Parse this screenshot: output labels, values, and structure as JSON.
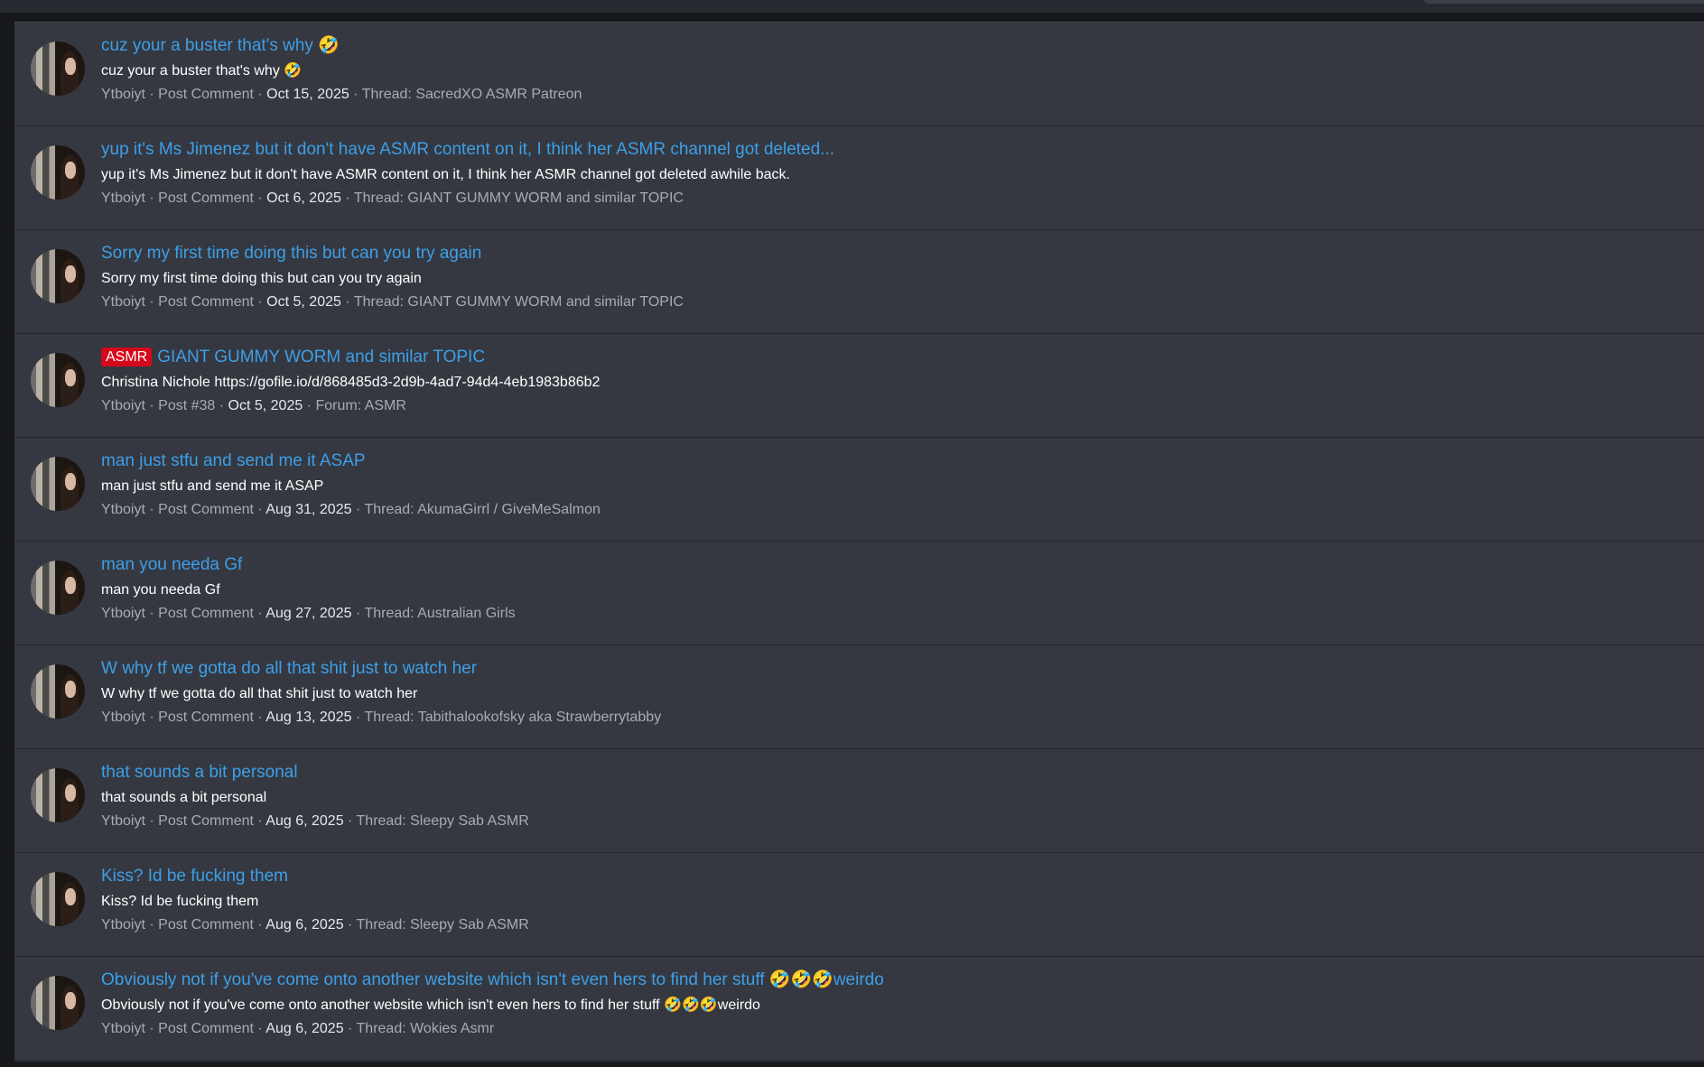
{
  "items": [
    {
      "title": "cuz your a buster that's why 🤣",
      "snippet": "cuz your a buster that's why 🤣",
      "user": "Ytboiyt",
      "type": "Post Comment",
      "date": "Oct 15, 2025",
      "location": "Thread: SacredXO ASMR Patreon"
    },
    {
      "title": "yup it's Ms Jimenez but it don't have ASMR content on it, I think her ASMR channel got deleted...",
      "snippet": "yup it's Ms Jimenez but it don't have ASMR content on it, I think her ASMR channel got deleted awhile back.",
      "user": "Ytboiyt",
      "type": "Post Comment",
      "date": "Oct 6, 2025",
      "location": "Thread: GIANT GUMMY WORM and similar TOPIC"
    },
    {
      "title": "Sorry my first time doing this but can you try again",
      "snippet": "Sorry my first time doing this but can you try again",
      "user": "Ytboiyt",
      "type": "Post Comment",
      "date": "Oct 5, 2025",
      "location": "Thread: GIANT GUMMY WORM and similar TOPIC"
    },
    {
      "prefix": "ASMR",
      "title": "GIANT GUMMY WORM and similar TOPIC",
      "snippet": "Christina Nichole https://gofile.io/d/868485d3-2d9b-4ad7-94d4-4eb1983b86b2",
      "user": "Ytboiyt",
      "type": "Post #38",
      "date": "Oct 5, 2025",
      "location": "Forum: ASMR"
    },
    {
      "title": "man just stfu and send me it ASAP",
      "snippet": "man just stfu and send me it ASAP",
      "user": "Ytboiyt",
      "type": "Post Comment",
      "date": "Aug 31, 2025",
      "location": "Thread: AkumaGirrl / GiveMeSalmon"
    },
    {
      "title": "man you needa Gf",
      "snippet": "man you needa Gf",
      "user": "Ytboiyt",
      "type": "Post Comment",
      "date": "Aug 27, 2025",
      "location": "Thread: Australian Girls"
    },
    {
      "title": "W why tf we gotta do all that shit just to watch her",
      "snippet": "W why tf we gotta do all that shit just to watch her",
      "user": "Ytboiyt",
      "type": "Post Comment",
      "date": "Aug 13, 2025",
      "location": "Thread: Tabithalookofsky aka Strawberrytabby"
    },
    {
      "title": "that sounds a bit personal",
      "snippet": "that sounds a bit personal",
      "user": "Ytboiyt",
      "type": "Post Comment",
      "date": "Aug 6, 2025",
      "location": "Thread: Sleepy Sab ASMR"
    },
    {
      "title": "Kiss? Id be fucking them",
      "snippet": "Kiss? Id be fucking them",
      "user": "Ytboiyt",
      "type": "Post Comment",
      "date": "Aug 6, 2025",
      "location": "Thread: Sleepy Sab ASMR"
    },
    {
      "title": "Obviously not if you've come onto another website which isn't even hers to find her stuff 🤣🤣🤣weirdo",
      "snippet": "Obviously not if you've come onto another website which isn't even hers to find her stuff 🤣🤣🤣weirdo",
      "user": "Ytboiyt",
      "type": "Post Comment",
      "date": "Aug 6, 2025",
      "location": "Thread: Wokies Asmr"
    }
  ],
  "meta_separator": " · ",
  "colors": {
    "link": "#3d9fe8",
    "panel": "#353840",
    "prefix_asmr": "#d6071b",
    "meta": "#a8abb0"
  },
  "avatar_icon": "user-avatar"
}
